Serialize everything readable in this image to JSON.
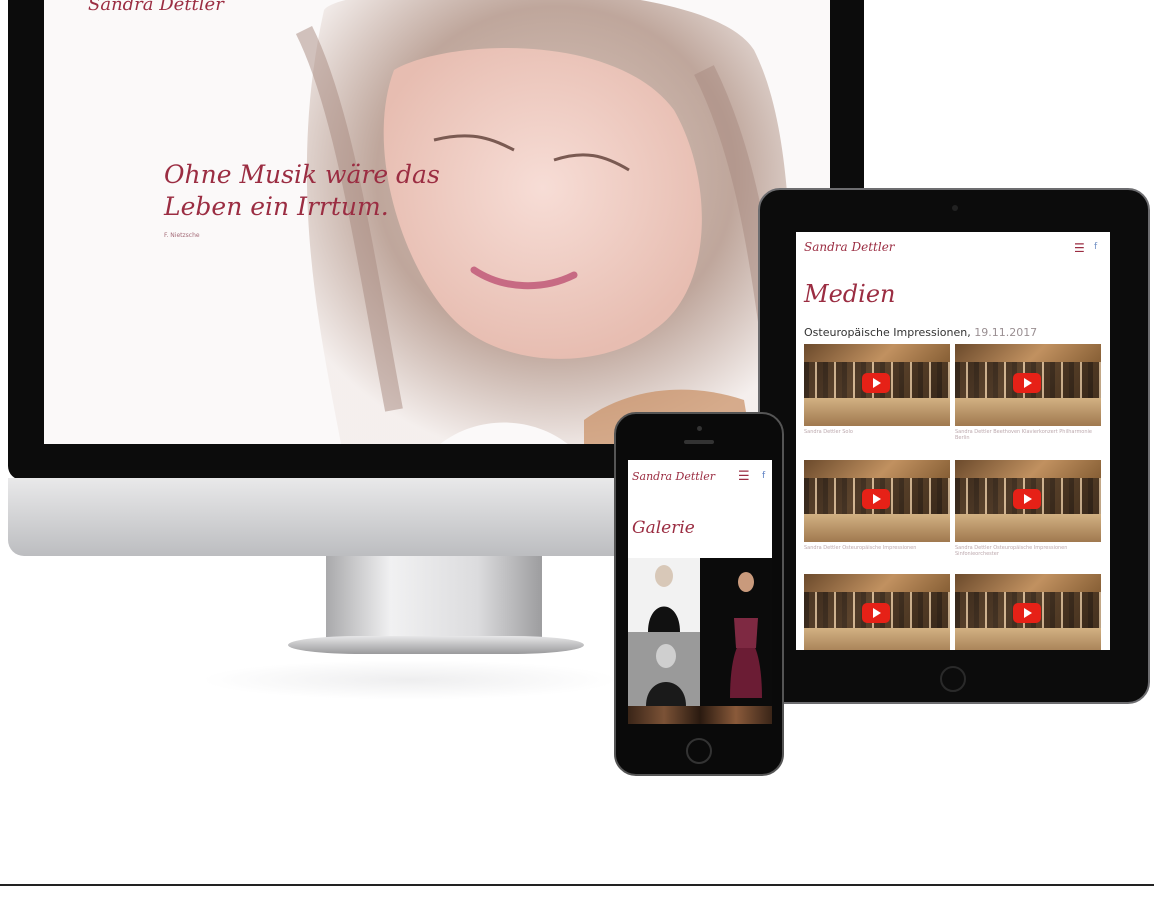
{
  "desktop": {
    "logo": "Sandra Dettler",
    "quote_line1": "Ohne Musik wäre das",
    "quote_line2": "Leben ein Irrtum.",
    "quote_author": "F. Nietzsche"
  },
  "tablet": {
    "logo": "Sandra Dettler",
    "menu_icon": "hamburger-icon",
    "fb_icon": "facebook-icon",
    "page_title": "Medien",
    "section_title": "Osteuropäische Impressionen,",
    "section_date": "19.11.2017",
    "videos": [
      {
        "caption": "Sandra Dettler Solo"
      },
      {
        "caption": "Sandra Dettler Beethoven Klavierkonzert Philharmonie Berlin"
      },
      {
        "caption": "Sandra Dettler Osteuropäische Impressionen"
      },
      {
        "caption": "Sandra Dettler Osteuropäische Impressionen Sinfonieorchester"
      },
      {
        "caption": ""
      },
      {
        "caption": ""
      }
    ],
    "accent_color": "#9b2d42"
  },
  "phone": {
    "logo": "Sandra Dettler",
    "menu_icon": "hamburger-icon",
    "fb_icon": "facebook-icon",
    "page_title": "Galerie"
  }
}
